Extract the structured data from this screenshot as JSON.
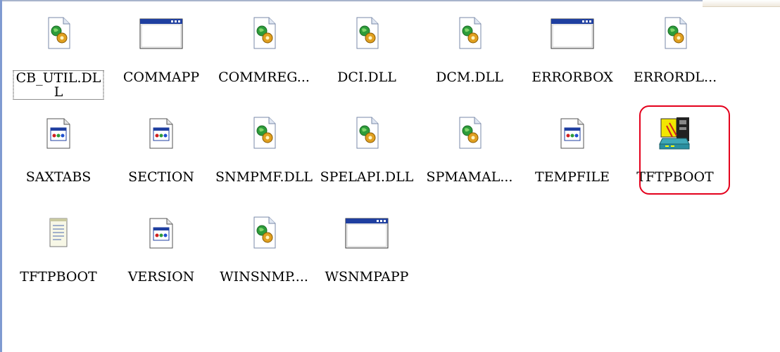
{
  "files": [
    {
      "name": "CB_UTIL.DLL",
      "label_line1": "CB_UTIL.DL",
      "label_line2": "L",
      "icon": "dll-icon"
    },
    {
      "name": "COMMAPP",
      "icon": "application-window-icon"
    },
    {
      "name": "COMMREG...",
      "icon": "dll-icon"
    },
    {
      "name": "DCI.DLL",
      "icon": "dll-icon"
    },
    {
      "name": "DCM.DLL",
      "icon": "dll-icon"
    },
    {
      "name": "ERRORBOX",
      "icon": "application-window-icon"
    },
    {
      "name": "ERRORDL...",
      "icon": "dll-icon"
    },
    {
      "name": "SAXTABS",
      "icon": "settings-file-icon"
    },
    {
      "name": "SECTION",
      "icon": "settings-file-icon"
    },
    {
      "name": "SNMPMF.DLL",
      "icon": "dll-icon"
    },
    {
      "name": "SPELAPI.DLL",
      "icon": "dll-icon"
    },
    {
      "name": "SPMAMAL...",
      "icon": "dll-icon"
    },
    {
      "name": "TEMPFILE",
      "icon": "settings-file-icon"
    },
    {
      "name": "TFTPBOOT",
      "icon": "network-program-icon"
    },
    {
      "name": "TFTPBOOT",
      "icon": "text-document-icon"
    },
    {
      "name": "VERSION",
      "icon": "settings-file-icon"
    },
    {
      "name": "WINSNMP....",
      "icon": "dll-icon"
    },
    {
      "name": "WSNMPAPP",
      "icon": "application-window-icon"
    }
  ],
  "colors": {
    "highlight": "#e4001c",
    "window_titlebar": "#1f3fa0",
    "dll_gear": "#e0a020",
    "dll_globe": "#2d9c3a"
  }
}
